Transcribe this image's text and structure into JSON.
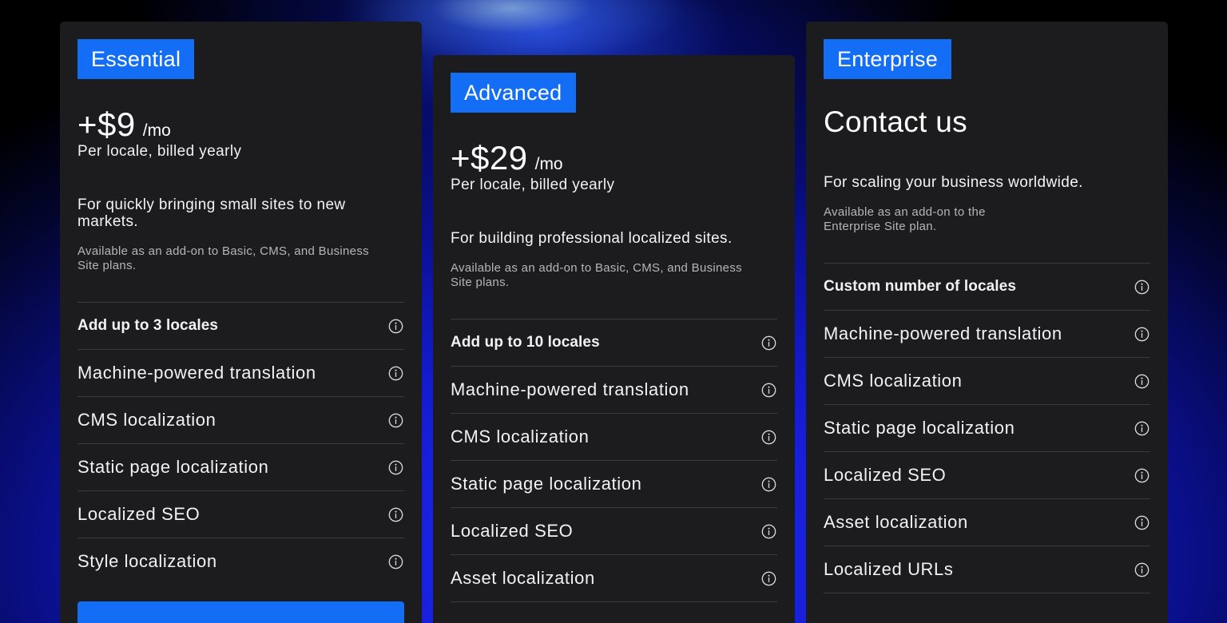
{
  "colors": {
    "accent": "#146ef5",
    "card_bg": "#1c1c1f",
    "divider": "#3a3a40",
    "text": "#ffffff",
    "muted_text": "#b5b5ba"
  },
  "plans": [
    {
      "tag": "Essential",
      "price": "+$9",
      "period": "/mo",
      "billing": "Per locale, billed yearly",
      "description": "For quickly bringing small sites to new markets.",
      "note": "Available as an add-on to Basic, CMS, and Business Site plans.",
      "features": [
        {
          "label": "Add up to 3 locales",
          "icon": "info-icon"
        },
        {
          "label": "Machine-powered translation",
          "icon": "info-icon"
        },
        {
          "label": "CMS localization",
          "icon": "info-icon"
        },
        {
          "label": "Static page localization",
          "icon": "info-icon"
        },
        {
          "label": "Localized SEO",
          "icon": "info-icon"
        },
        {
          "label": "Style localization",
          "icon": "info-icon"
        }
      ]
    },
    {
      "tag": "Advanced",
      "price": "+$29",
      "period": "/mo",
      "billing": "Per locale, billed yearly",
      "description": "For building professional localized sites.",
      "note": "Available as an add-on to Basic, CMS, and Business Site plans.",
      "features": [
        {
          "label": "Add up to 10 locales",
          "icon": "info-icon"
        },
        {
          "label": "Machine-powered translation",
          "icon": "info-icon"
        },
        {
          "label": "CMS localization",
          "icon": "info-icon"
        },
        {
          "label": "Static page localization",
          "icon": "info-icon"
        },
        {
          "label": "Localized SEO",
          "icon": "info-icon"
        },
        {
          "label": "Asset localization",
          "icon": "info-icon"
        }
      ]
    },
    {
      "tag": "Enterprise",
      "headline": "Contact us",
      "description": "For scaling your business worldwide.",
      "note": "Available as an add-on to the Enterprise Site plan.",
      "features": [
        {
          "label": "Custom number of locales",
          "icon": "info-icon"
        },
        {
          "label": "Machine-powered translation",
          "icon": "info-icon"
        },
        {
          "label": "CMS localization",
          "icon": "info-icon"
        },
        {
          "label": "Static page localization",
          "icon": "info-icon"
        },
        {
          "label": "Localized SEO",
          "icon": "info-icon"
        },
        {
          "label": "Asset localization",
          "icon": "info-icon"
        },
        {
          "label": "Localized URLs",
          "icon": "info-icon"
        }
      ]
    }
  ]
}
